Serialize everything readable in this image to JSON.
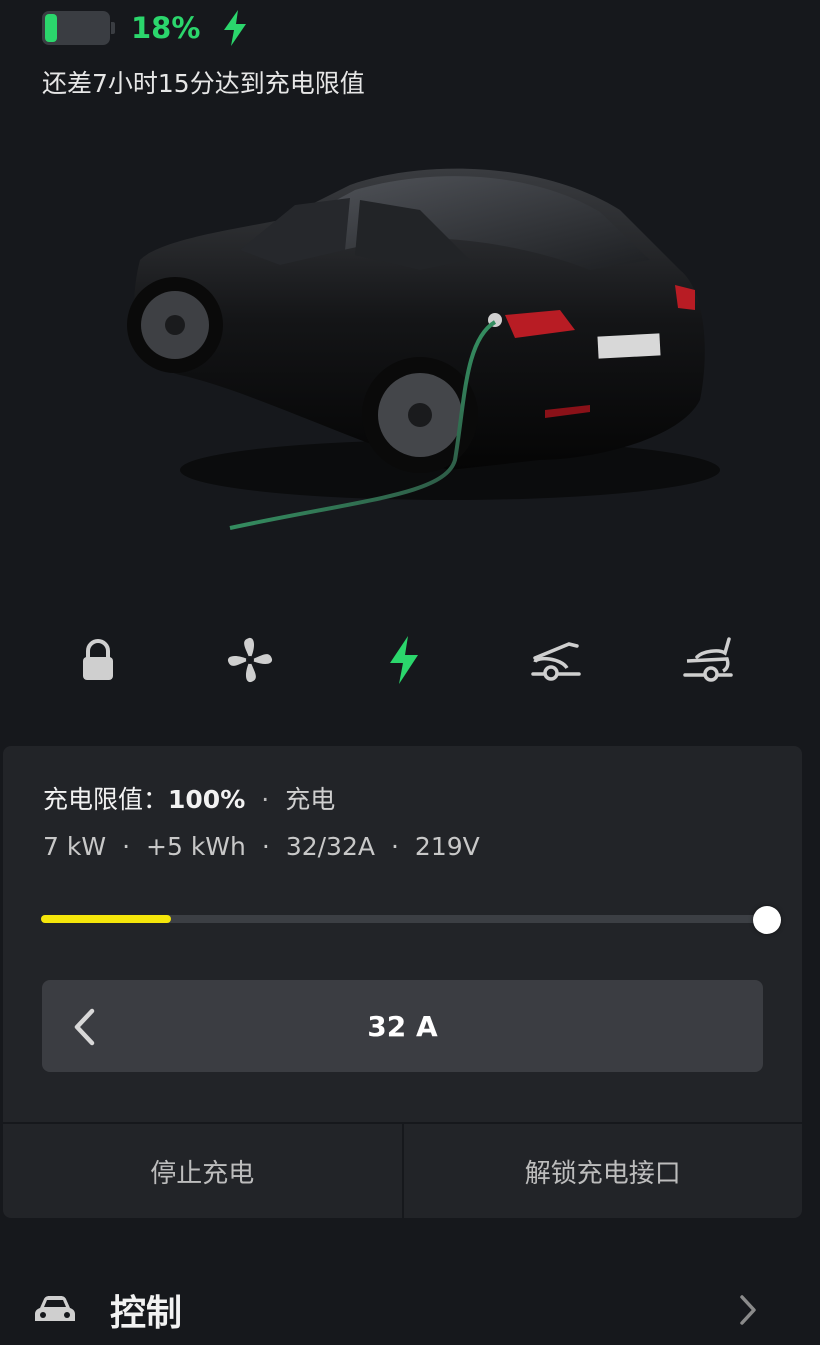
{
  "status": {
    "battery_percent": "18%",
    "battery_level": 0.18,
    "charging_icon": "bolt-icon",
    "remaining_text": "还差7小时15分达到充电限值"
  },
  "quick_controls": [
    {
      "icon": "lock-icon"
    },
    {
      "icon": "fan-icon"
    },
    {
      "icon": "charge-bolt-icon",
      "active": true
    },
    {
      "icon": "frunk-icon"
    },
    {
      "icon": "trunk-icon"
    }
  ],
  "charging": {
    "limit_label": "充电限值：",
    "limit_value": "100%",
    "dot": "·",
    "mode": "充电",
    "stats": [
      "7 kW",
      "+5 kWh",
      "32/32A",
      "219V"
    ],
    "current_level": 0.18,
    "limit_level": 1.0,
    "amperage": "32 A",
    "stop_button": "停止充电",
    "unlock_button": "解锁充电接口"
  },
  "nav": {
    "control_label": "控制"
  },
  "colors": {
    "accent_green": "#2bd66c",
    "charge_yellow": "#f5e60a",
    "background": "#16181c",
    "panel": "#222428"
  }
}
